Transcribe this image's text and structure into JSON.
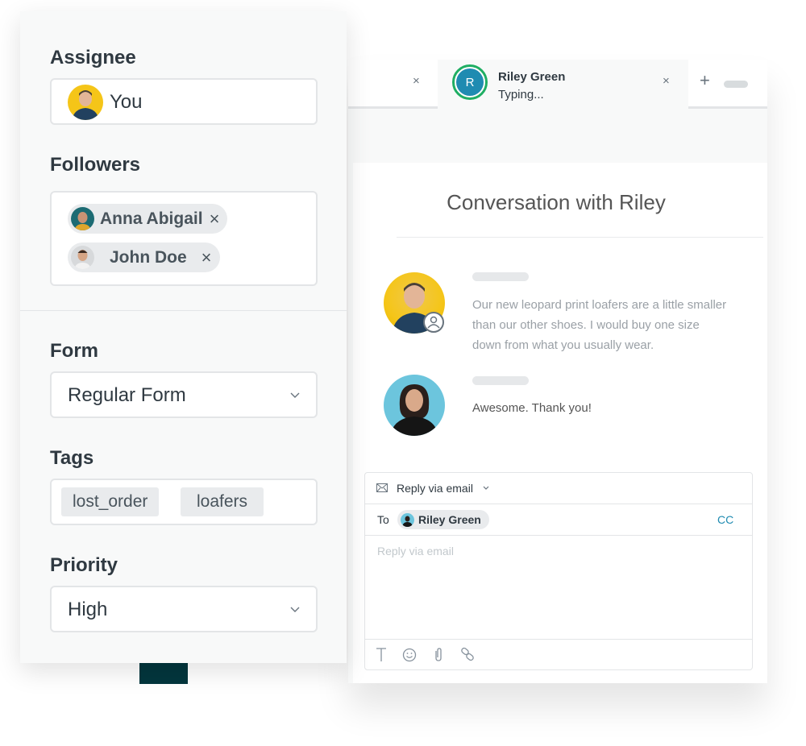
{
  "tabs": [
    {
      "label": "",
      "close_icon": "×"
    },
    {
      "name": "Riley Green",
      "status": "Typing...",
      "avatar_initial": "R",
      "close_icon": "×"
    }
  ],
  "tab_actions": {
    "add_icon": "+"
  },
  "conversation": {
    "title": "Conversation with Riley",
    "messages": [
      {
        "author": "agent",
        "text": "Our new leopard print loafers are a little smaller than our other shoes. I would buy one size down from what you usually wear."
      },
      {
        "author": "customer",
        "text": "Awesome. Thank you!"
      }
    ]
  },
  "reply": {
    "channel_label": "Reply via email",
    "to_label": "To",
    "recipient": "Riley Green",
    "cc_label": "CC",
    "placeholder": "Reply via email"
  },
  "properties": {
    "assignee": {
      "label": "Assignee",
      "value": "You"
    },
    "followers": {
      "label": "Followers",
      "items": [
        "Anna Abigail",
        "John Doe"
      ],
      "remove_icon": "×"
    },
    "form": {
      "label": "Form",
      "value": "Regular Form"
    },
    "tags": {
      "label": "Tags",
      "items": [
        "lost_order",
        "loafers"
      ]
    },
    "priority": {
      "label": "Priority",
      "value": "High"
    }
  },
  "colors": {
    "accent": "#1f8bb1",
    "online": "#1fae63",
    "cc_link": "#1f8bb1",
    "brand_dark": "#03363d"
  }
}
